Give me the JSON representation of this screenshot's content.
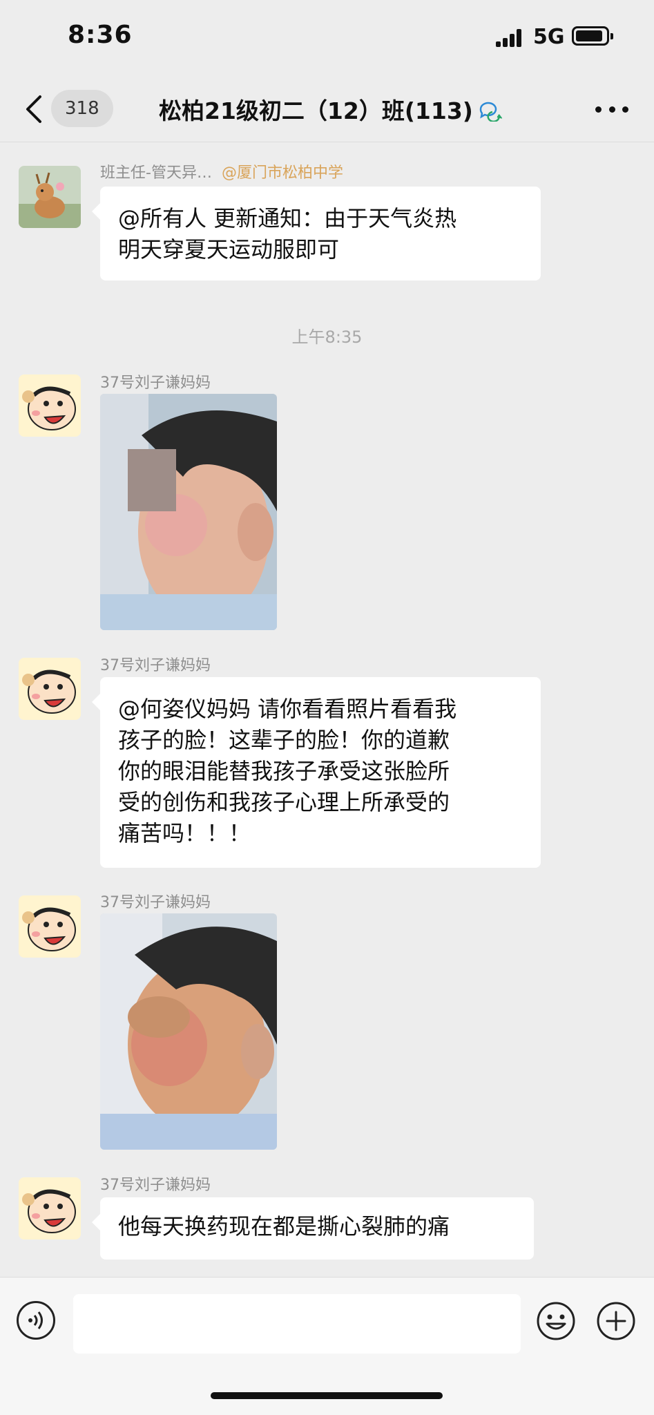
{
  "status_bar": {
    "time": "8:36",
    "network": "5G"
  },
  "nav": {
    "unread_count": "318",
    "title": "松柏21级初二（12）班(113)"
  },
  "messages": [
    {
      "sender": "班主任-管天异…",
      "sender_org": "@厦门市松柏中学",
      "lines": [
        "@所有人 更新通知：由于天气炎热",
        "明天穿夏天运动服即可"
      ]
    },
    {
      "sender": "37号刘子谦妈妈"
    },
    {
      "sender": "37号刘子谦妈妈",
      "lines": [
        "@何姿仪妈妈 请你看看照片看看我",
        "孩子的脸！这辈子的脸！你的道歉",
        "你的眼泪能替我孩子承受这张脸所",
        "受的创伤和我孩子心理上所承受的",
        "痛苦吗！！！"
      ]
    },
    {
      "sender": "37号刘子谦妈妈"
    },
    {
      "sender": "37号刘子谦妈妈",
      "lines": [
        "他每天换药现在都是撕心裂肺的痛"
      ]
    }
  ],
  "time_separator": "上午8:35",
  "input": {
    "placeholder": ""
  },
  "colors": {
    "background": "#ededed",
    "bubble": "#ffffff",
    "org_tag": "#d9a45a"
  }
}
